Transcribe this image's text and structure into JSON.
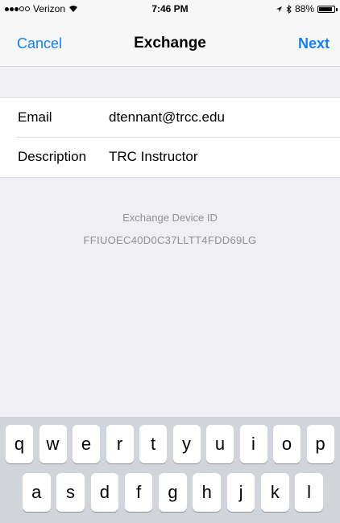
{
  "status_bar": {
    "carrier": "Verizon",
    "time": "7:46 PM",
    "battery": "88%",
    "battery_level": 0.88,
    "icons": [
      "signal-dots-icon",
      "wifi-icon",
      "location-arrow-icon",
      "bluetooth-icon",
      "battery-icon"
    ]
  },
  "nav": {
    "cancel_label": "Cancel",
    "title": "Exchange",
    "next_label": "Next"
  },
  "form": {
    "email_label": "Email",
    "email_value": "dtennant@trcc.edu",
    "description_label": "Description",
    "description_value": "TRC Instructor"
  },
  "device": {
    "label": "Exchange Device ID",
    "id": "FFIUOEC40D0C37LLTT4FDD69LG"
  },
  "keyboard": {
    "row1": [
      "q",
      "w",
      "e",
      "r",
      "t",
      "y",
      "u",
      "i",
      "o",
      "p"
    ],
    "row2": [
      "a",
      "s",
      "d",
      "f",
      "g",
      "h",
      "j",
      "k",
      "l"
    ]
  },
  "colors": {
    "accent": "#147efb",
    "background": "#efeff4",
    "secondary_text": "#8e8e93",
    "keyboard_bg": "#d1d4da"
  }
}
